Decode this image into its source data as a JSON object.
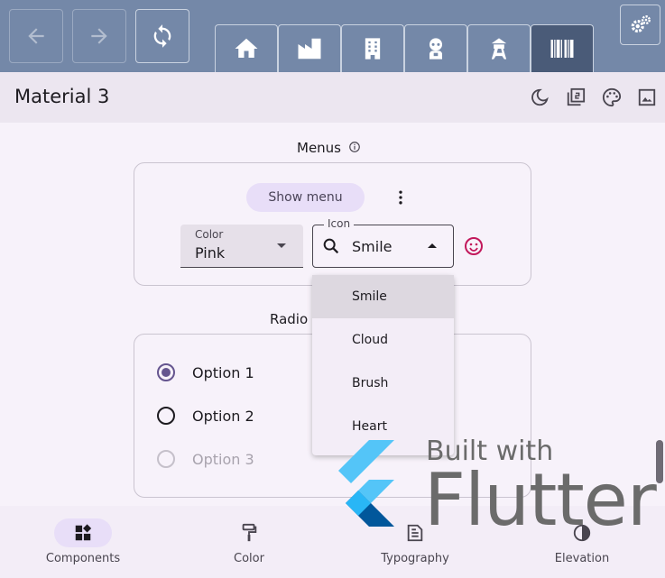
{
  "appbar": {
    "title": "Material 3"
  },
  "menus_section": {
    "title": "Menus",
    "show_menu_label": "Show menu",
    "color_field": {
      "label": "Color",
      "value": "Pink"
    },
    "icon_field": {
      "label": "Icon",
      "value": "Smile"
    },
    "icon_menu": {
      "items": [
        "Smile",
        "Cloud",
        "Brush",
        "Heart"
      ],
      "selected": "Smile"
    }
  },
  "radio_section": {
    "title": "Radio",
    "options": [
      {
        "label": "Option 1",
        "state": "selected"
      },
      {
        "label": "Option 2",
        "state": "unselected"
      },
      {
        "label": "Option 3",
        "state": "disabled"
      }
    ]
  },
  "bottom_nav": {
    "items": [
      {
        "label": "Components",
        "icon": "widgets-icon",
        "active": true
      },
      {
        "label": "Color",
        "icon": "format-paint-icon",
        "active": false
      },
      {
        "label": "Typography",
        "icon": "text-snippet-icon",
        "active": false
      },
      {
        "label": "Elevation",
        "icon": "contrast-icon",
        "active": false
      }
    ]
  },
  "watermark": {
    "line1": "Built with",
    "line2": "Flutter"
  },
  "colors": {
    "topbar": "#7488a8",
    "active_tab": "#4a5b78",
    "primary": "#65558f",
    "accent_pink": "#c2185b"
  }
}
